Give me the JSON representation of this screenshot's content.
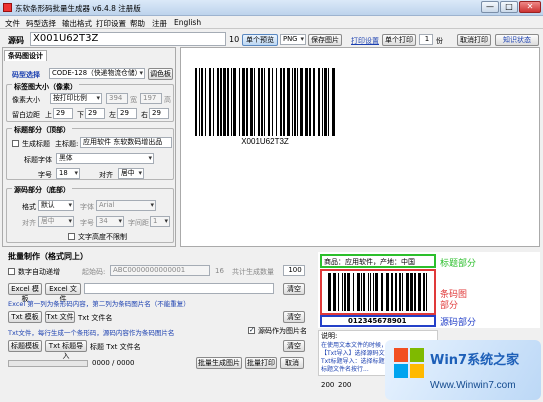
{
  "window": {
    "title": "东软条形码批量生成器 v6.4.8 注册版",
    "min": "—",
    "max": "□",
    "close": "✕"
  },
  "menu": [
    "文件",
    "码型选择",
    "输出格式",
    "打印设置",
    "帮助",
    "注册",
    "English"
  ],
  "toolbar": {
    "code_label": "源码",
    "code_value": "X001U62T3Z",
    "length": "10",
    "preview_btn": "单个预览",
    "format": "PNG",
    "save_img_btn": "保存图片",
    "print_settings_link": "打印设置",
    "print_single_btn": "单个打印",
    "copies": "1",
    "copies_unit": "份",
    "cancel_print_btn": "取消打印",
    "about_btn": "知识状态"
  },
  "panel": {
    "title": "条码图设计",
    "type_label": "码型选择",
    "type_value": "CODE-128（快递物流仓储）",
    "type_btn": "调色板",
    "size_title": "标签图大小（像素）",
    "size_mode": "按打印比例",
    "size_prefix": "像素大小",
    "width": "394",
    "width_unit": "宽",
    "height": "197",
    "height_unit": "高",
    "margin_label": "留白边距",
    "margins": [
      {
        "side": "上",
        "value": "29"
      },
      {
        "side": "下",
        "value": "29"
      },
      {
        "side": "左",
        "value": "29"
      },
      {
        "side": "右",
        "value": "29"
      }
    ],
    "header_title": "标题部分（顶部）",
    "gen_header_label": "生成标题",
    "main_title_label": "主标题:",
    "main_title_value": "应用软件 东软数码增出品",
    "title_font_label": "标题字体",
    "title_font_value": "黑体",
    "font_size_label": "字号",
    "font_size_value": "18",
    "align_label": "对齐",
    "align_value": "居中",
    "footer_title": "源码部分（底部）",
    "format_label": "格式",
    "format_value": "默认",
    "font_label": "字体",
    "font_value": "Arial",
    "align2_label": "对齐",
    "align2_value": "居中",
    "size2_label": "字号",
    "size2_value": "34",
    "spacing_label": "字间距",
    "spacing_value": "1",
    "no_limit_label": "文字高度不限制"
  },
  "preview": {
    "barcode_text": "X001U62T3Z"
  },
  "batch": {
    "title": "批量制作（格式同上）",
    "auto_inc_label": "数字自动递增",
    "start_label": "起始码:",
    "start_value": "ABC0000000000001",
    "len": "16",
    "count_label": "共计生成数量",
    "count_value": "100",
    "excel_tpl_btn": "Excel 模板",
    "excel_file_btn": "Excel 文件",
    "clear1_btn": "清空",
    "excel_note": "Excel 第一列为条形码内容，第二列为条码图片名（不能重复）",
    "txt_tpl_btn": "Txt 模板",
    "txt_file_btn": "Txt 文件",
    "txt_name_label": "Txt 文件名",
    "clear2_btn": "清空",
    "txt_note": "Txt文件，每行生成一个条形码，源码内容作为条码图片名",
    "as_filename_label": "源码作为图片名",
    "title_tpl_btn": "标题模板",
    "title_import_btn": "Txt 标题导入",
    "title_txt_label": "标题 Txt 文件名",
    "clear3_btn": "清空",
    "progress_text": "0000 / 0000",
    "batch_gen_btn": "批量生成图片",
    "batch_print_btn": "批量打印",
    "cancel_btn": "取消"
  },
  "sample": {
    "header_text": "商品：应用软件，产地：中国",
    "header_label": "标题部分",
    "middle_label_1": "条码图",
    "middle_label_2": "部分",
    "code_text": "012345678901",
    "code_label": "源码部分",
    "note_title": "说明:",
    "note_lines": [
      "在使用文本文件的时候，源码txt和标题txt配合使用",
      "【Txt导入】选择源码文件txt",
      "Txt标题导入：选择标题文件txt",
      "标题文件名按行..."
    ],
    "w_value": "200",
    "h_value": "200"
  },
  "watermark": {
    "text": "Www.Winwin7.com",
    "brand": "Win7系统之家"
  }
}
